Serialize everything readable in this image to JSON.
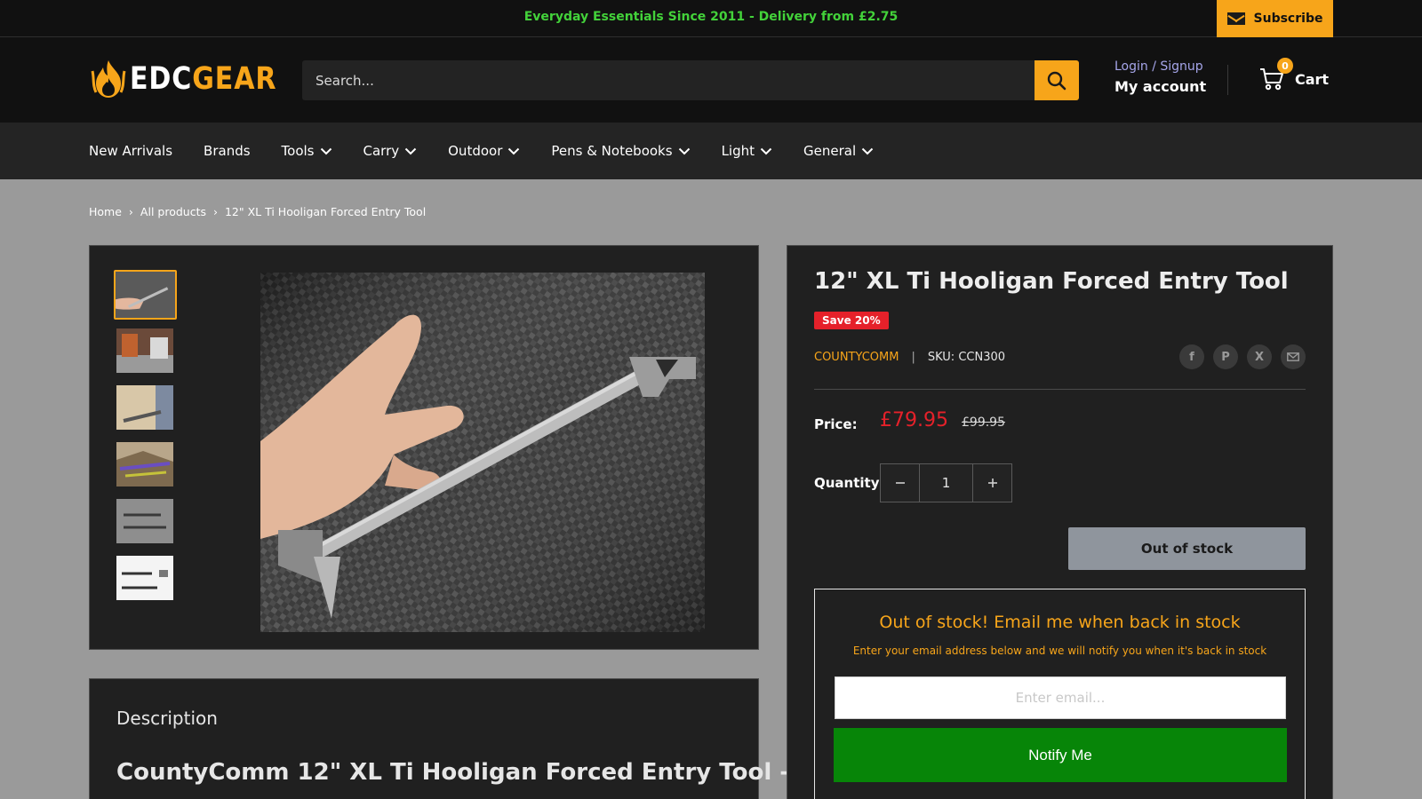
{
  "announcement": {
    "text": "Everyday Essentials Since 2011 - Delivery from £2.75",
    "subscribe_label": "Subscribe"
  },
  "header": {
    "logo_edc": "EDC",
    "logo_gear": "GEAR",
    "search_placeholder": "Search...",
    "login_label": "Login / Signup",
    "account_label": "My account",
    "cart_count": "0",
    "cart_label": "Cart"
  },
  "nav": {
    "items": [
      {
        "label": "New Arrivals"
      },
      {
        "label": "Brands"
      },
      {
        "label": "Tools"
      },
      {
        "label": "Carry"
      },
      {
        "label": "Outdoor"
      },
      {
        "label": "Pens & Notebooks"
      },
      {
        "label": "Light"
      },
      {
        "label": "General"
      }
    ]
  },
  "breadcrumb": {
    "home": "Home",
    "all_products": "All products",
    "current": "12\" XL Ti Hooligan Forced Entry Tool"
  },
  "product": {
    "title": "12\" XL Ti Hooligan Forced Entry Tool",
    "save_badge": "Save 20%",
    "vendor": "COUNTYCOMM",
    "vendor_sep": "|",
    "sku": "SKU: CCN300",
    "price_label": "Price:",
    "price_new": "£79.95",
    "price_old": "£99.95",
    "quantity_label": "Quantity:",
    "quantity_value": "1",
    "out_of_stock_label": "Out of stock"
  },
  "notify": {
    "title": "Out of stock! Email me when back in stock",
    "subtitle": "Enter your email address below and we will notify you when it's back in stock",
    "email_placeholder": "Enter email...",
    "button_label": "Notify Me"
  },
  "description": {
    "title": "Description",
    "heading": "CountyComm 12\" XL Ti Hooligan Forced Entry Tool -"
  },
  "colors": {
    "accent": "#f7a51a",
    "announcement_text": "#43d23a",
    "sale_red": "#e5212a",
    "notify_green": "#078508"
  },
  "share_icons": [
    "facebook-icon",
    "pinterest-icon",
    "x-twitter-icon",
    "email-icon"
  ],
  "thumbnails_count": 6
}
